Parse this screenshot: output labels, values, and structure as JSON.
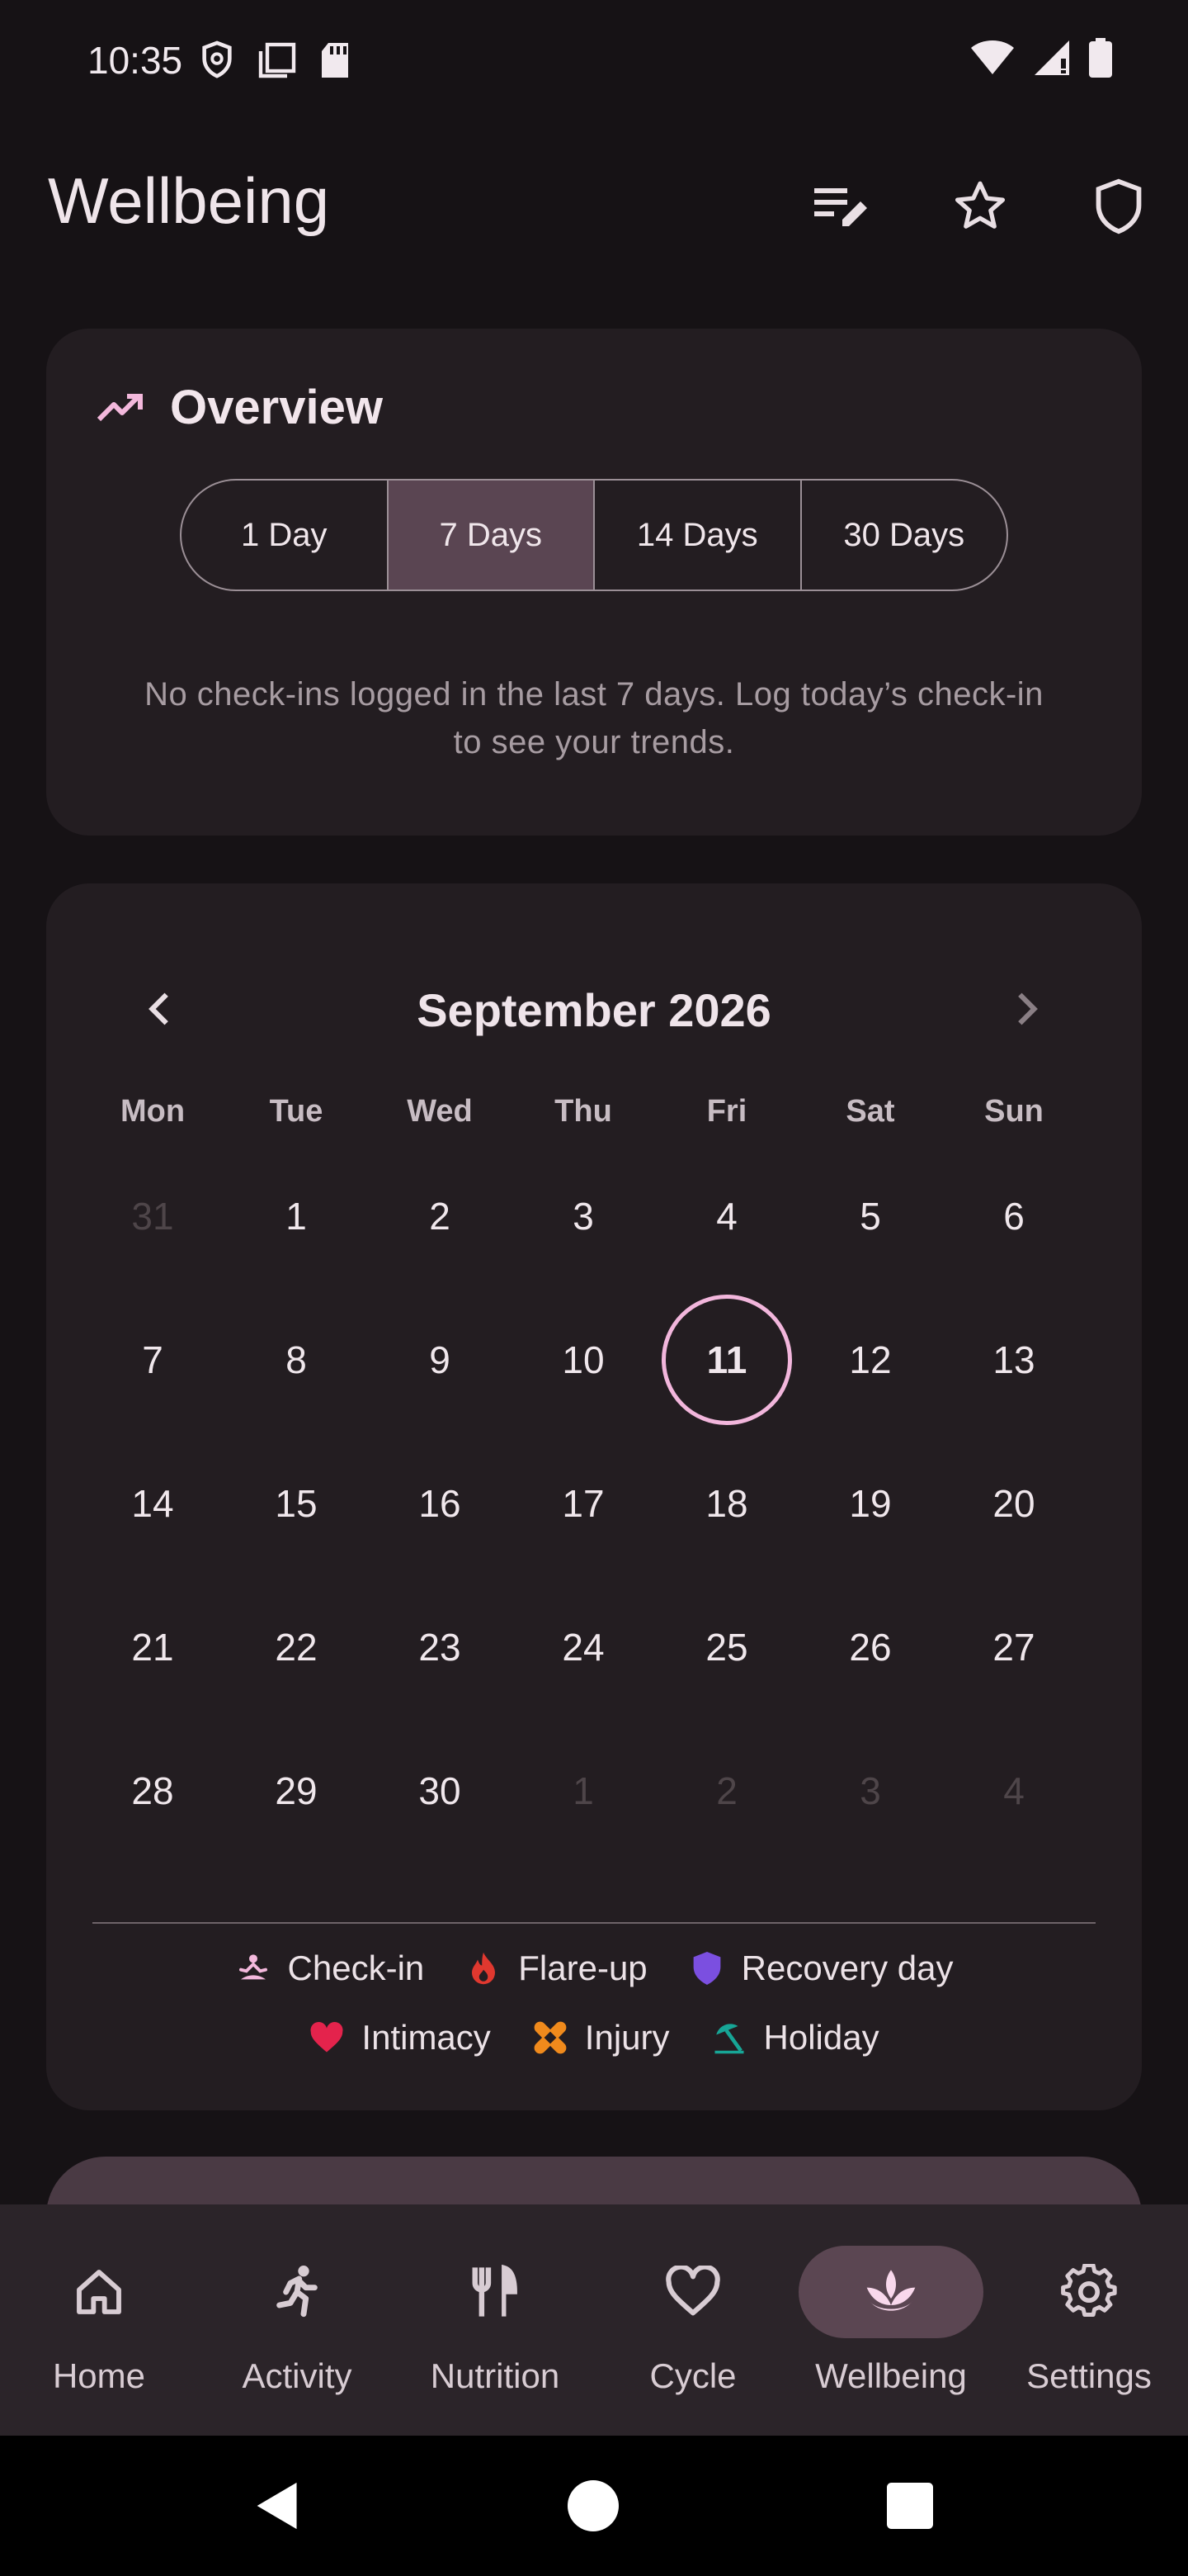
{
  "status_bar": {
    "time": "10:35",
    "left_icons": [
      "shield-icon",
      "screen-icon",
      "sd-card-icon"
    ],
    "right_icons": [
      "wifi-icon",
      "signal-icon",
      "battery-icon"
    ]
  },
  "app_bar": {
    "title": "Wellbeing",
    "actions": [
      "edit-list-icon",
      "star-icon",
      "shield-icon"
    ]
  },
  "overview": {
    "title": "Overview",
    "icon": "trending-up-icon",
    "ranges": [
      "1 Day",
      "7 Days",
      "14 Days",
      "30 Days"
    ],
    "selected_range": "7 Days",
    "empty_message": "No check-ins logged in the last 7 days. Log today’s check-in to see your trends."
  },
  "calendar": {
    "month_label": "September 2026",
    "weekdays": [
      "Mon",
      "Tue",
      "Wed",
      "Thu",
      "Fri",
      "Sat",
      "Sun"
    ],
    "weeks": [
      [
        "31",
        "1",
        "2",
        "3",
        "4",
        "5",
        "6"
      ],
      [
        "7",
        "8",
        "9",
        "10",
        "11",
        "12",
        "13"
      ],
      [
        "14",
        "15",
        "16",
        "17",
        "18",
        "19",
        "20"
      ],
      [
        "21",
        "22",
        "23",
        "24",
        "25",
        "26",
        "27"
      ],
      [
        "28",
        "29",
        "30",
        "1",
        "2",
        "3",
        "4"
      ]
    ],
    "today": "11",
    "legend": [
      {
        "label": "Check-in",
        "icon": "meditation-icon",
        "color": "#f3b8dc"
      },
      {
        "label": "Flare-up",
        "icon": "flame-icon",
        "color": "#e0382f"
      },
      {
        "label": "Recovery day",
        "icon": "shield-icon",
        "color": "#7b4fe0"
      },
      {
        "label": "Intimacy",
        "icon": "heart-icon",
        "color": "#e4234c"
      },
      {
        "label": "Injury",
        "icon": "bandage-icon",
        "color": "#f08a1c"
      },
      {
        "label": "Holiday",
        "icon": "umbrella-beach-icon",
        "color": "#17a596"
      }
    ]
  },
  "bottom_nav": {
    "items": [
      {
        "label": "Home",
        "icon": "home-icon"
      },
      {
        "label": "Activity",
        "icon": "running-icon"
      },
      {
        "label": "Nutrition",
        "icon": "fork-knife-icon"
      },
      {
        "label": "Cycle",
        "icon": "heart-outline-icon"
      },
      {
        "label": "Wellbeing",
        "icon": "lotus-icon"
      },
      {
        "label": "Settings",
        "icon": "gear-icon"
      }
    ],
    "active": "Wellbeing"
  },
  "system_nav": [
    "back-icon",
    "home-circle-icon",
    "recents-icon"
  ]
}
